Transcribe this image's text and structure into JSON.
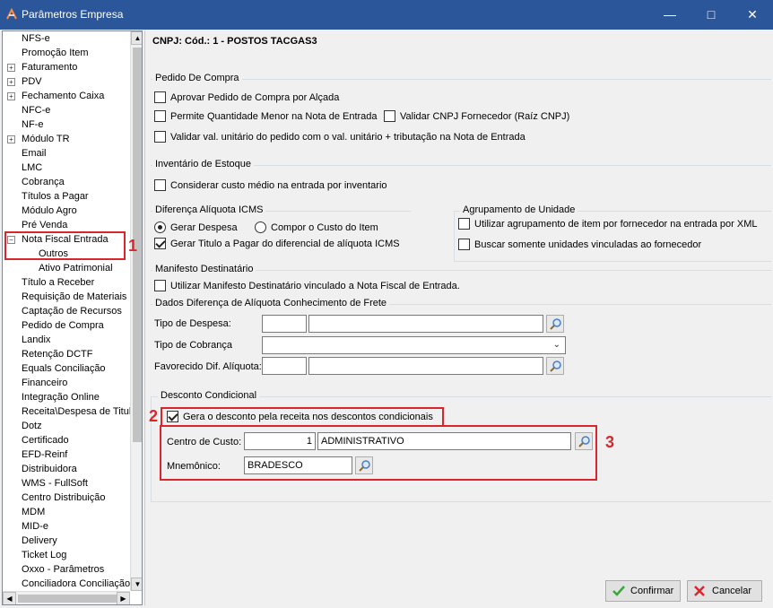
{
  "window": {
    "title": "Parâmetros Empresa",
    "minimize_icon": "minimize-icon",
    "maximize_icon": "maximize-icon",
    "close_icon": "close-icon"
  },
  "tree": {
    "items": [
      {
        "label": "NFS-e",
        "expandable": false
      },
      {
        "label": "Promoção Item",
        "expandable": false
      },
      {
        "label": "Faturamento",
        "expandable": true
      },
      {
        "label": "PDV",
        "expandable": true
      },
      {
        "label": "Fechamento Caixa",
        "expandable": true
      },
      {
        "label": "NFC-e",
        "expandable": false
      },
      {
        "label": "NF-e",
        "expandable": false
      },
      {
        "label": "Módulo TR",
        "expandable": true
      },
      {
        "label": "Email",
        "expandable": false
      },
      {
        "label": "LMC",
        "expandable": false
      },
      {
        "label": "Cobrança",
        "expandable": false
      },
      {
        "label": "Títulos a Pagar",
        "expandable": false
      },
      {
        "label": "Módulo Agro",
        "expandable": false
      },
      {
        "label": "Pré Venda",
        "expandable": false
      },
      {
        "label": "Nota Fiscal Entrada",
        "expandable": true,
        "expanded": true
      },
      {
        "label": "Outros",
        "expandable": false,
        "child": true,
        "selected": true
      },
      {
        "label": "Ativo Patrimonial",
        "expandable": false,
        "child": true
      },
      {
        "label": "Título a Receber",
        "expandable": false
      },
      {
        "label": "Requisição de Materiais",
        "expandable": false
      },
      {
        "label": "Captação de Recursos",
        "expandable": false
      },
      {
        "label": "Pedido de Compra",
        "expandable": false
      },
      {
        "label": "Landix",
        "expandable": false
      },
      {
        "label": "Retenção DCTF",
        "expandable": false
      },
      {
        "label": "Equals Conciliação",
        "expandable": false
      },
      {
        "label": "Financeiro",
        "expandable": false
      },
      {
        "label": "Integração Online",
        "expandable": false
      },
      {
        "label": "Receita\\Despesa de Titul",
        "expandable": false
      },
      {
        "label": "Dotz",
        "expandable": false
      },
      {
        "label": "Certificado",
        "expandable": false
      },
      {
        "label": "EFD-Reinf",
        "expandable": false
      },
      {
        "label": "Distribuidora",
        "expandable": false
      },
      {
        "label": "WMS - FullSoft",
        "expandable": false
      },
      {
        "label": "Centro Distribuição",
        "expandable": false
      },
      {
        "label": "MDM",
        "expandable": false
      },
      {
        "label": "MID-e",
        "expandable": false
      },
      {
        "label": "Delivery",
        "expandable": false
      },
      {
        "label": "Ticket Log",
        "expandable": false
      },
      {
        "label": "Oxxo - Parâmetros",
        "expandable": false
      },
      {
        "label": "Conciliadora Conciliação",
        "expandable": false
      }
    ]
  },
  "header": {
    "cnpj": "CNPJ: Cód.: 1 - POSTOS TACGAS3"
  },
  "pedido_compra": {
    "title": "Pedido De Compra",
    "aprovar": "Aprovar Pedido de Compra por Alçada",
    "permite": "Permite Quantidade Menor na Nota de Entrada",
    "validar_cnpj": "Validar CNPJ Fornecedor (Raíz CNPJ)",
    "validar_val": "Validar val. unitário do pedido com o val. unitário + tributação na Nota de Entrada"
  },
  "inventario": {
    "title": "Inventário de Estoque",
    "considerar": "Considerar custo médio na entrada por inventario"
  },
  "diferenca_icms": {
    "title": "Diferença Alíquota ICMS",
    "gerar_despesa": "Gerar Despesa",
    "compor_custo": "Compor o Custo do Item",
    "gerar_titulo": "Gerar Titulo a Pagar do diferencial de alíquota ICMS"
  },
  "agrupamento": {
    "title": "Agrupamento de Unidade",
    "utilizar": "Utilizar agrupamento de item por fornecedor na entrada por XML",
    "buscar": "Buscar somente unidades vinculadas ao fornecedor"
  },
  "manifesto": {
    "title": "Manifesto Destinatário",
    "utilizar": "Utilizar Manifesto Destinatário vinculado a Nota Fiscal de Entrada."
  },
  "frete": {
    "title": "Dados Diferença de Alíquota Conhecimento de Frete",
    "tipo_despesa": "Tipo de Despesa:",
    "tipo_cobranca": "Tipo de Cobrança",
    "favorecido": "Favorecido Dif. Alíquota:"
  },
  "desconto": {
    "title": "Desconto Condicional",
    "gera": "Gera o desconto pela receita nos descontos condicionais",
    "centro_label": "Centro de Custo:",
    "centro_code": "1",
    "centro_name": "ADMINISTRATIVO",
    "mnemonico_label": "Mnemônico:",
    "mnemonico_value": "BRADESCO"
  },
  "annotations": {
    "n1": "1",
    "n2": "2",
    "n3": "3"
  },
  "buttons": {
    "confirmar": "Confirmar",
    "cancelar": "Cancelar"
  },
  "colors": {
    "titlebar": "#2b579a",
    "annotation": "#d9262c",
    "confirm_icon": "#3aa53a",
    "cancel_icon": "#d9262c"
  }
}
